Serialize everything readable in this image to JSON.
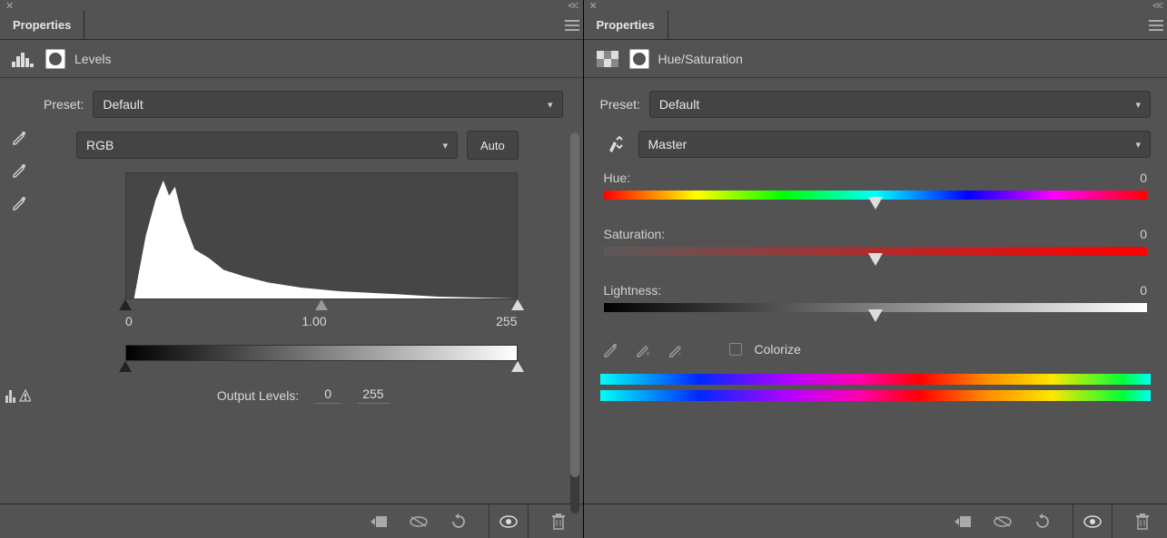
{
  "left": {
    "tab_title": "Properties",
    "adjustment_name": "Levels",
    "preset_label": "Preset:",
    "preset_value": "Default",
    "channel_value": "RGB",
    "auto_label": "Auto",
    "input_black": "0",
    "input_gamma": "1.00",
    "input_white": "255",
    "output_label": "Output Levels:",
    "output_black": "0",
    "output_white": "255"
  },
  "right": {
    "tab_title": "Properties",
    "adjustment_name": "Hue/Saturation",
    "preset_label": "Preset:",
    "preset_value": "Default",
    "range_value": "Master",
    "hue_label": "Hue:",
    "hue_value": "0",
    "sat_label": "Saturation:",
    "sat_value": "0",
    "light_label": "Lightness:",
    "light_value": "0",
    "colorize_label": "Colorize"
  }
}
